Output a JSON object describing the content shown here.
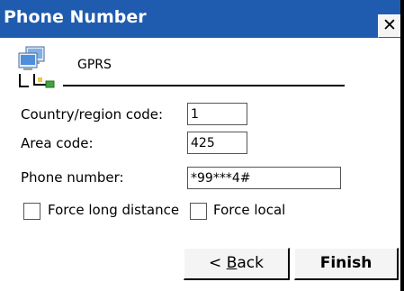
{
  "window": {
    "title": "Phone Number",
    "close_glyph": "✕",
    "close_icon": "close-icon"
  },
  "connection": {
    "icon": "network-connection-icon",
    "name": "GPRS"
  },
  "form": {
    "country_label": "Country/region code:",
    "country_value": "1",
    "area_label": "Area code:",
    "area_value": "425",
    "phone_label": "Phone number:",
    "phone_value": "*99***4#"
  },
  "options": {
    "force_long_distance_label": "Force long distance",
    "force_long_distance_checked": false,
    "force_local_label": "Force local",
    "force_local_checked": false
  },
  "buttons": {
    "back_prefix": "< ",
    "back_mnemonic": "B",
    "back_rest": "ack",
    "finish_label": "Finish"
  },
  "colors": {
    "titlebar": "#1f5cb0",
    "background": "#ffffff"
  }
}
